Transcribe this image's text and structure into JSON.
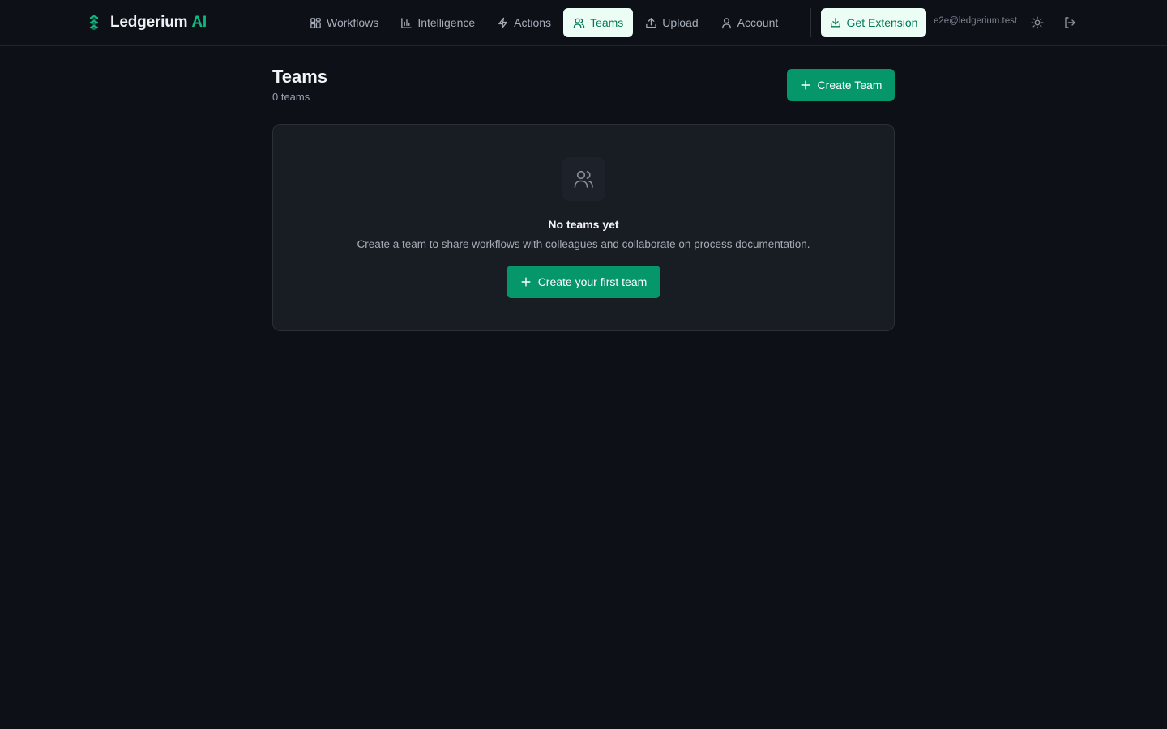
{
  "brand": {
    "name": "Ledgerium",
    "suffix": "AI",
    "logo_icon": "stacked-chevrons-logo",
    "accent_color": "#10b981"
  },
  "nav": {
    "items": [
      {
        "label": "Workflows",
        "icon": "grid-icon",
        "active": false
      },
      {
        "label": "Intelligence",
        "icon": "bar-chart-icon",
        "active": false
      },
      {
        "label": "Actions",
        "icon": "lightning-icon",
        "active": false
      },
      {
        "label": "Teams",
        "icon": "users-icon",
        "active": true
      },
      {
        "label": "Upload",
        "icon": "upload-icon",
        "active": false
      },
      {
        "label": "Account",
        "icon": "user-icon",
        "active": false
      }
    ],
    "active_bg": "#ecfdf5",
    "active_color": "#047857"
  },
  "header_actions": {
    "extension_label": "Get Extension",
    "extension_icon": "download-icon",
    "user_email": "e2e@ledgerium.test",
    "theme_icon": "sun-icon",
    "logout_icon": "logout-icon"
  },
  "page": {
    "title": "Teams",
    "subtitle": "0 teams",
    "create_button_label": "Create Team",
    "button_color": "#059669"
  },
  "empty_state": {
    "icon": "users-icon",
    "title": "No teams yet",
    "description": "Create a team to share workflows with colleagues and collaborate on process documentation.",
    "button_label": "Create your first team"
  }
}
